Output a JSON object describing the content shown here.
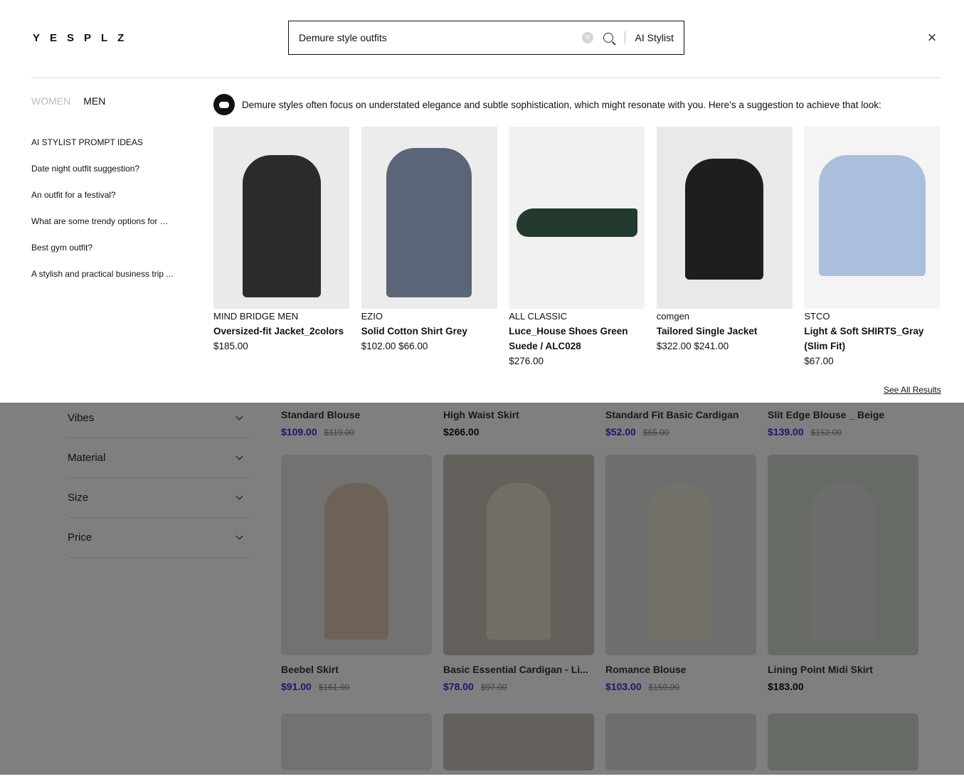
{
  "header": {
    "logo": "YESPLZ",
    "search_value": "Demure style outfits",
    "ai_stylist": "AI Stylist"
  },
  "gender_tabs": [
    {
      "label": "WOMEN",
      "active": false
    },
    {
      "label": "MEN",
      "active": true
    }
  ],
  "prompts": {
    "title": "AI STYLIST PROMPT IDEAS",
    "items": [
      "Date night outfit suggestion?",
      "An outfit for a festival?",
      "What are some trendy options for m...",
      "Best gym outfit?",
      "A stylish and practical business trip ..."
    ]
  },
  "stylist_message": "Demure styles often focus on understated elegance and subtle sophistication, which might resonate with you. Here’s a suggestion to achieve that look:",
  "suggestions": [
    {
      "brand": "MIND BRIDGE MEN",
      "name": "Oversized-fit Jacket_2colors",
      "price": "$185.00"
    },
    {
      "brand": "EZIO",
      "name": "Solid Cotton Shirt Grey",
      "price": "$102.00 $66.00"
    },
    {
      "brand": "ALL CLASSIC",
      "name": "Luce_House Shoes Green Suede / ALC028",
      "price": "$276.00"
    },
    {
      "brand": "comgen",
      "name": "Tailored Single Jacket",
      "price": "$322.00 $241.00"
    },
    {
      "brand": "STCO",
      "name": "Light & Soft SHIRTS_Gray (Slim Fit)",
      "price": "$67.00"
    }
  ],
  "see_all": "See All Results",
  "filters": [
    "Vibes",
    "Material",
    "Size",
    "Price"
  ],
  "products_row1": [
    {
      "name": "Standard Blouse",
      "price": "$109.00",
      "old": "$119.00"
    },
    {
      "name": "High Waist Skirt",
      "price": "$266.00",
      "old": ""
    },
    {
      "name": "Standard Fit Basic Cardigan",
      "price": "$52.00",
      "old": "$65.00"
    },
    {
      "name": "Slit Edge Blouse _ Beige",
      "price": "$139.00",
      "old": "$152.00"
    }
  ],
  "products_row2": [
    {
      "name": "Beebel Skirt",
      "price": "$91.00",
      "old": "$161.00"
    },
    {
      "name": "Basic Essential Cardigan - Li...",
      "price": "$78.00",
      "old": "$97.00"
    },
    {
      "name": "Romance Blouse",
      "price": "$103.00",
      "old": "$159.00"
    },
    {
      "name": "Lining Point Midi Skirt",
      "price": "$183.00",
      "old": ""
    }
  ],
  "colors": {
    "sale_price": "#3b2ee0",
    "overlay": "rgba(0,0,0,0.5)"
  }
}
